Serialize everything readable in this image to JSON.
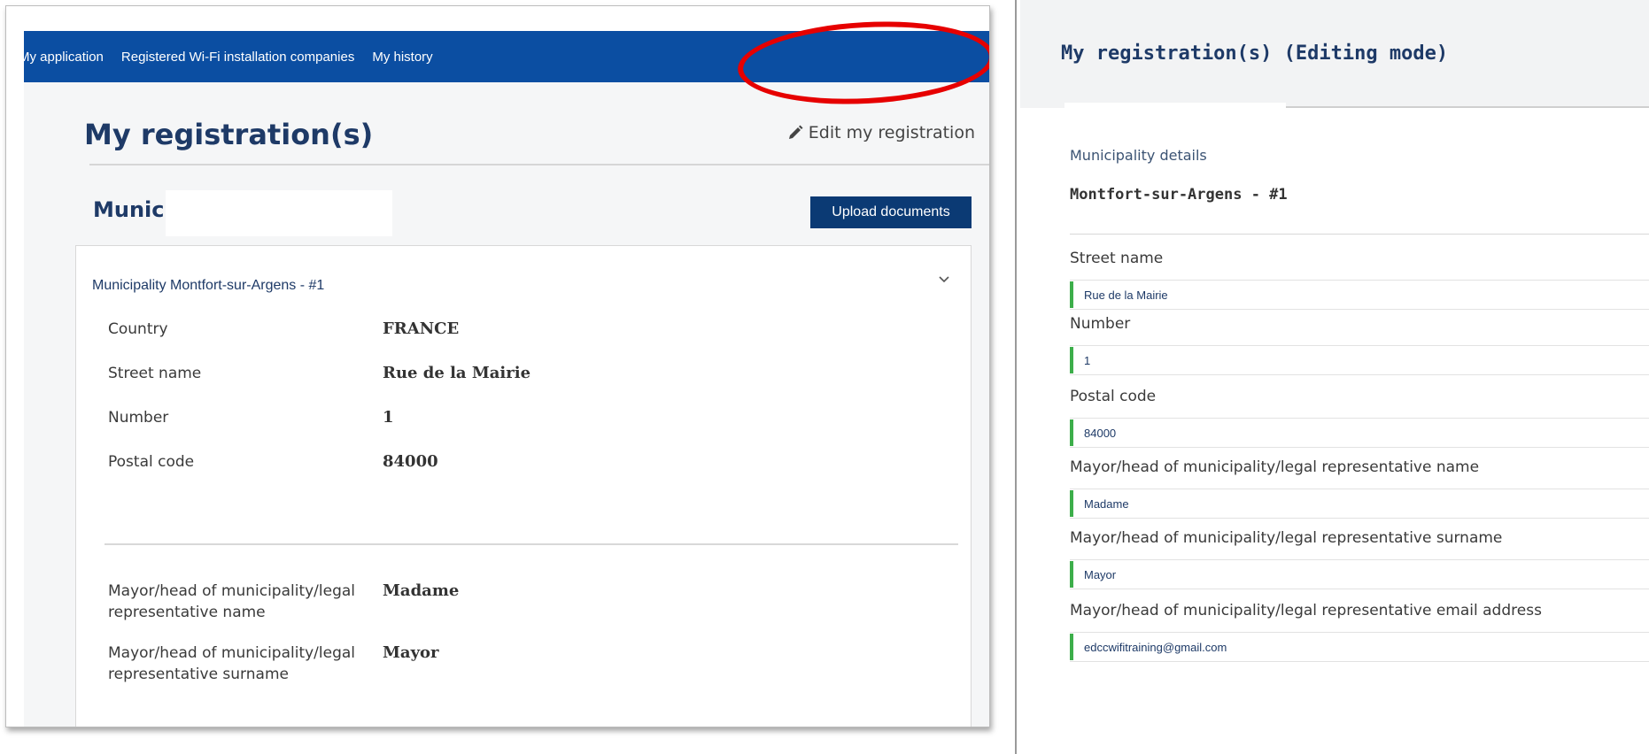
{
  "left": {
    "nav": {
      "items": [
        {
          "label": "My application"
        },
        {
          "label": "Registered Wi-Fi installation companies"
        },
        {
          "label": "My history"
        }
      ]
    },
    "page_title": "My registration(s)",
    "edit_link_label": "Edit my registration",
    "section_heading": "Munici",
    "upload_button_label": "Upload documents",
    "card": {
      "title": "Municipality Montfort-sur-Argens - #1",
      "fields": [
        {
          "label": "Country",
          "value": "FRANCE"
        },
        {
          "label": "Street name",
          "value": "Rue de la Mairie"
        },
        {
          "label": "Number",
          "value": "1"
        },
        {
          "label": "Postal code",
          "value": "84000"
        },
        {
          "label": "Mayor/head of municipality/legal representative name",
          "value": "Madame"
        },
        {
          "label": "Mayor/head of municipality/legal representative surname",
          "value": "Mayor"
        }
      ]
    }
  },
  "right": {
    "title": "My registration(s) (Editing mode)",
    "section_label": "Municipality details",
    "section_title": "Montfort-sur-Argens - #1",
    "fields": [
      {
        "label": "Street name",
        "value": "Rue de la Mairie"
      },
      {
        "label": "Number",
        "value": "1"
      },
      {
        "label": "Postal code",
        "value": "84000"
      },
      {
        "label": "Mayor/head of municipality/legal representative name",
        "value": "Madame"
      },
      {
        "label": "Mayor/head of municipality/legal representative surname",
        "value": "Mayor"
      },
      {
        "label": "Mayor/head of municipality/legal representative email address",
        "value": "edccwifitraining@gmail.com"
      }
    ]
  },
  "colors": {
    "nav_blue": "#0b4ea2",
    "heading_navy": "#1e3a67",
    "button_navy": "#0b3a74",
    "highlight_red": "#e60000",
    "input_accent_green": "#3cae4a"
  },
  "icons": {
    "edit": "pencil-icon",
    "expand": "chevron-down-icon"
  }
}
